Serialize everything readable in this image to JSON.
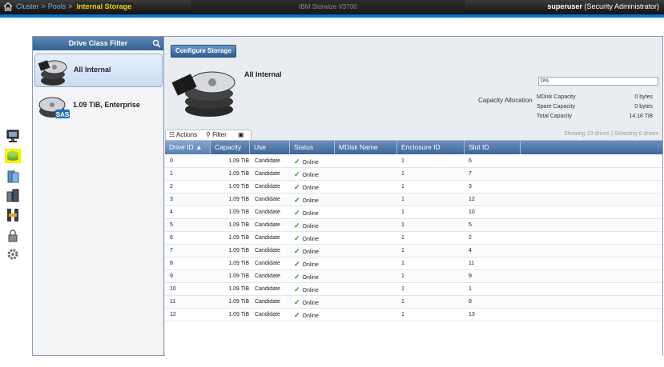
{
  "topbar": {
    "breadcrumb": [
      "Cluster",
      "Pools",
      "Internal Storage"
    ],
    "product": "IBM Storwize V3700",
    "user": "superuser",
    "role": "(Security Administrator)"
  },
  "nav_icons": [
    "monitoring-icon",
    "pools-icon",
    "volumes-icon",
    "hosts-icon",
    "copy-services-icon",
    "access-icon",
    "settings-icon"
  ],
  "filter": {
    "title": "Drive Class Filter",
    "items": [
      {
        "label": "All Internal",
        "selected": true
      },
      {
        "label": "1.09 TiB, Enterprise",
        "badge": "SAS",
        "selected": false
      }
    ]
  },
  "main": {
    "configure_label": "Configure Storage",
    "title": "All Internal",
    "capacity_label": "Capacity Allocation",
    "progress_value": 0,
    "progress_text": "0%",
    "stats": [
      {
        "key": "MDisk Capacity",
        "value": "0 bytes"
      },
      {
        "key": "Spare Capacity",
        "value": "0 bytes"
      },
      {
        "key": "Total Capacity",
        "value": "14.18 TiB"
      }
    ],
    "toolbar": {
      "actions": "Actions",
      "filter": "Filter"
    },
    "showing": "Showing 13 drives | Selecting 0 drives"
  },
  "table": {
    "columns": [
      "Drive ID",
      "Capacity",
      "Use",
      "Status",
      "MDisk Name",
      "Enclosure ID",
      "Slot ID"
    ],
    "rows": [
      [
        "0",
        "1.09 TiB",
        "Candidate",
        "Online",
        "",
        "1",
        "6"
      ],
      [
        "1",
        "1.09 TiB",
        "Candidate",
        "Online",
        "",
        "1",
        "7"
      ],
      [
        "2",
        "1.09 TiB",
        "Candidate",
        "Online",
        "",
        "1",
        "3"
      ],
      [
        "3",
        "1.09 TiB",
        "Candidate",
        "Online",
        "",
        "1",
        "12"
      ],
      [
        "4",
        "1.09 TiB",
        "Candidate",
        "Online",
        "",
        "1",
        "10"
      ],
      [
        "5",
        "1.09 TiB",
        "Candidate",
        "Online",
        "",
        "1",
        "5"
      ],
      [
        "6",
        "1.09 TiB",
        "Candidate",
        "Online",
        "",
        "1",
        "2"
      ],
      [
        "7",
        "1.09 TiB",
        "Candidate",
        "Online",
        "",
        "1",
        "4"
      ],
      [
        "8",
        "1.09 TiB",
        "Candidate",
        "Online",
        "",
        "1",
        "11"
      ],
      [
        "9",
        "1.09 TiB",
        "Candidate",
        "Online",
        "",
        "1",
        "9"
      ],
      [
        "10",
        "1.09 TiB",
        "Candidate",
        "Online",
        "",
        "1",
        "1"
      ],
      [
        "11",
        "1.09 TiB",
        "Candidate",
        "Online",
        "",
        "1",
        "8"
      ],
      [
        "12",
        "1.09 TiB",
        "Candidate",
        "Online",
        "",
        "1",
        "13"
      ]
    ]
  }
}
